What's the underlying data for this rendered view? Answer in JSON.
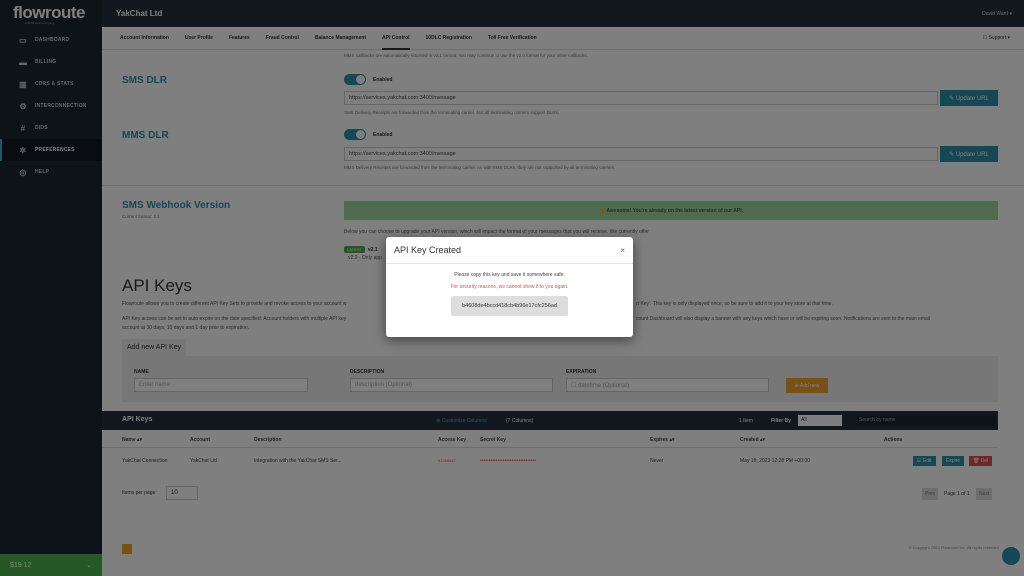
{
  "sidebar": {
    "logo": "flowroute",
    "logo_tag": "a BCM One Company",
    "items": [
      {
        "icon": "dashboard-icon",
        "glyph": "▭",
        "label": "DASHBOARD"
      },
      {
        "icon": "billing-icon",
        "glyph": "▬",
        "label": "BILLING"
      },
      {
        "icon": "cdrs-icon",
        "glyph": "▥",
        "label": "CDRS & STATS"
      },
      {
        "icon": "interconnection-icon",
        "glyph": "⚙",
        "label": "INTERCONNECTION"
      },
      {
        "icon": "dids-icon",
        "glyph": "#",
        "label": "DIDS"
      },
      {
        "icon": "preferences-icon",
        "glyph": "✲",
        "label": "PREFERENCES"
      },
      {
        "icon": "help-icon",
        "glyph": "◎",
        "label": "HELP"
      }
    ],
    "balance": "$19.12",
    "balance_caret": "⌄"
  },
  "topbar": {
    "company": "YakChat Ltd",
    "user": "David Ward ▾"
  },
  "tabs": [
    "Account Information",
    "User Profile",
    "Features",
    "Fraud Control",
    "Balance Management",
    "API Control",
    "10DLC Registration",
    "Toll Free Verification"
  ],
  "support": "☐ Support ▾",
  "mms_callback_note": "MMS callbacks are automatically returned in v2.1 format. You may continue to use the v2.0 format for your other callbacks.",
  "sms_dlr": {
    "title": "SMS DLR",
    "toggle_label": "Enabled",
    "url": "https://services.yakchat.com:3400/message",
    "button": "✎ Update URL",
    "note": "SMS Delivery Receipts are forwarded from the terminating carrier. Not all terminating carriers support DLRs."
  },
  "mms_dlr": {
    "title": "MMS DLR",
    "toggle_label": "Enabled",
    "url": "https://services.yakchat.com:3400/message",
    "button": "✎ Update URL",
    "note": "MMS Delivery Receipts are forwarded from the terminating carrier. As with SMS DLRs, they are not supported by all terminating carriers."
  },
  "webhook": {
    "title": "SMS Webhook Version",
    "current": "Current format: 2.1",
    "banner": "👍 Awesome! You're already on the latest version of our API.",
    "upgrade_note": "Below you can choose to upgrade your API version, which will impact the format of your messages that you will receive. We currently offer",
    "latest_badge": "LATEST",
    "v21": "v2.1",
    "v20": "v2.0 - Only app"
  },
  "api_keys": {
    "title": "API Keys",
    "desc1": "Flowroute allows you to create different API Key Sets to provide and revoke access to your account w",
    "desc1_tail": "rt Key'. This key is only displayed once, so be sure to add it to your key store at that time.",
    "desc2": "API Key access can be set to auto expire on the date specified. Account holders with multiple API key",
    "desc2_tail": "count Dashboard will also display a banner with any keys which have or will be expiring soon. Notifications are sent to the main email",
    "desc3": "account at 30 days, 10 days and 1 day prior to expiration.",
    "add_tab": "Add new API Key",
    "name_label": "NAME",
    "name_placeholder": "Enter name",
    "desc_label": "DESCRIPTION",
    "desc_placeholder": "description (Optional)",
    "exp_label": "EXPIRATION",
    "exp_placeholder": "☐ datetime (Optional)",
    "add_button": "⊕ Add new"
  },
  "table": {
    "title": "API Keys",
    "customize": "⚙ Customize Columns",
    "column_count": "(7 Columns)",
    "item_count": "1 Item",
    "filter_by": "Filter By",
    "filter_value": "All",
    "search_placeholder": "Search by name",
    "columns": [
      "Name ▴▾",
      "Account",
      "Description",
      "Access Key",
      "Secret Key",
      "Expires ▴▾",
      "Created ▴▾",
      "Actions"
    ],
    "row": {
      "name": "YakChat Connection",
      "account": "YakChat Ltd",
      "description": "Integration with the YakChat SMS Ser...",
      "access_key": "61268447",
      "secret_key": "••••••••••••••••••••••••••••••••",
      "expires": "Never",
      "created": "May 18, 2023 12:28 PM +00:00",
      "edit": "☑ Edit",
      "expire": "Expire",
      "del": "🗑 Del"
    },
    "items_per_page_label": "Items per page:",
    "items_per_page": "10",
    "prev": "Prev",
    "page": "Page 1 of 1",
    "next": "Next"
  },
  "footer": "© Copyright 2023 Flowroute Inc. All rights reserved.",
  "modal": {
    "title": "API Key Created",
    "close": "×",
    "line1": "Please copy this key and save it somewhere safe.",
    "line2": "For security reasons, we cannot show it to you again.",
    "key": "b4608de4bccd418cb4b96e17cfc256ad"
  },
  "colors": {
    "sidebar": "#1d2630",
    "accent": "#2a8fa8",
    "balance": "#4cae4c",
    "warning": "#d9534f",
    "orange": "#f0a030"
  }
}
